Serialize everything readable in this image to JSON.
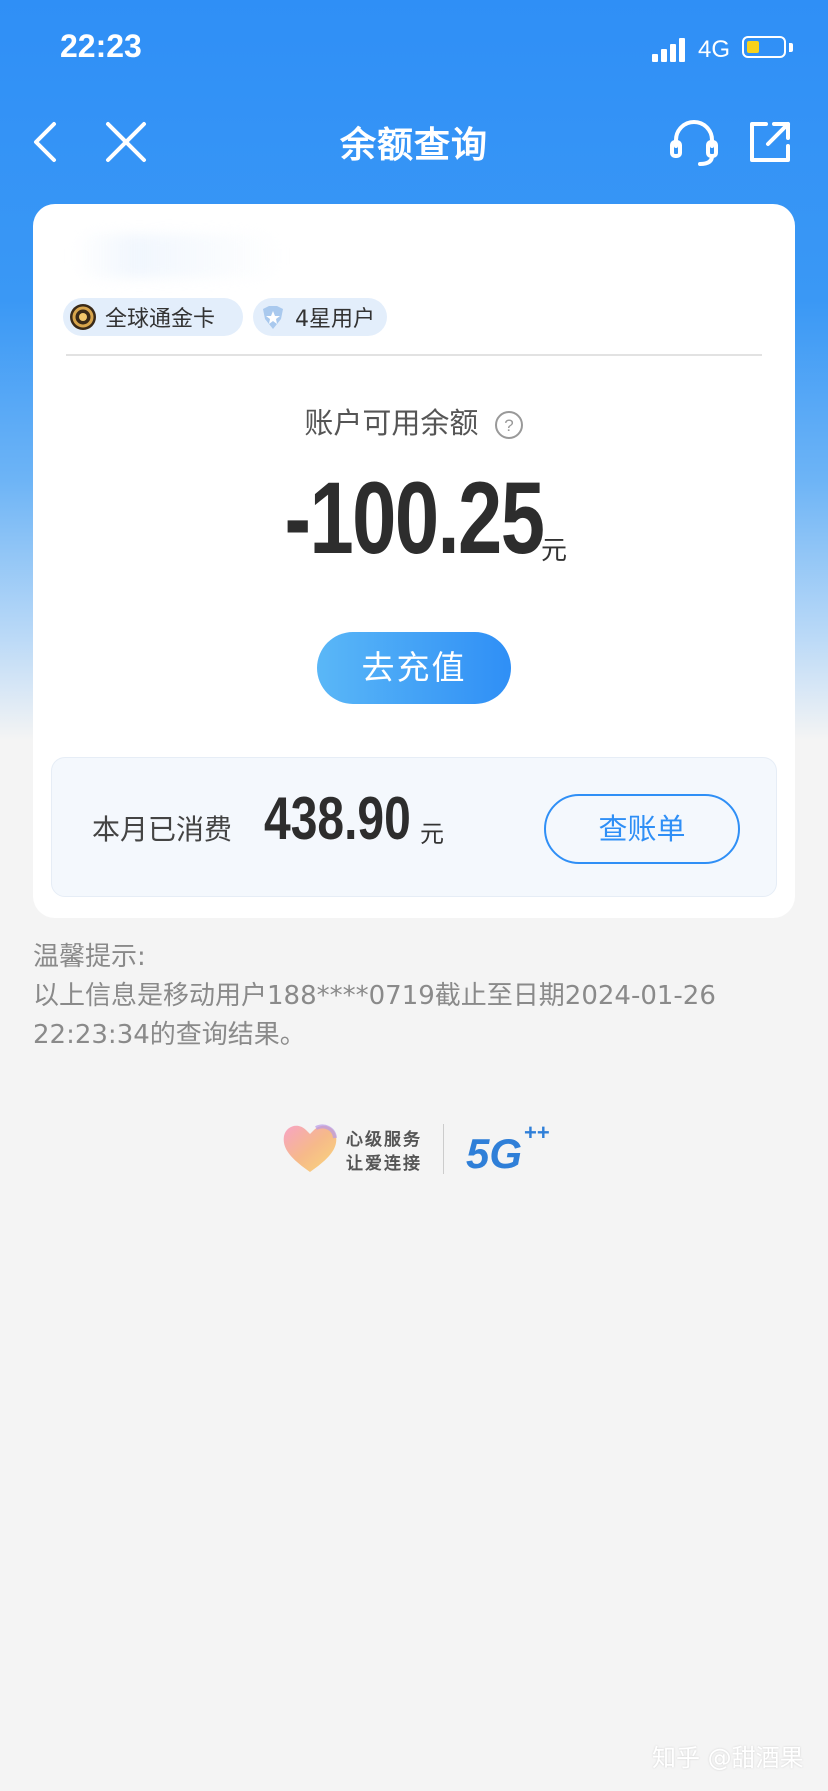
{
  "status_bar": {
    "time": "22:23",
    "network": "4G",
    "battery_level": 0.35,
    "signal_bars": 4
  },
  "nav": {
    "title": "余额查询",
    "icons": [
      "back-icon",
      "close-icon",
      "customer-service-icon",
      "share-icon"
    ]
  },
  "card": {
    "tags": [
      {
        "label": "全球通金卡",
        "icon": "gold-card-icon"
      },
      {
        "label": "4星用户",
        "icon": "star-badge-icon"
      }
    ],
    "balance_label": "账户可用余额",
    "balance_amount": "-100.25",
    "balance_unit": "元",
    "recharge_label": "去充值",
    "consume": {
      "label": "本月已消费",
      "amount": "438.90",
      "unit": "元",
      "bill_button": "查账单"
    }
  },
  "tips": {
    "title": "温馨提示:",
    "line1": "以上信息是移动用户188****0719截止至日期2024-01-26",
    "line2": "22:23:34的查询结果。"
  },
  "brand": {
    "slogan_line1": "心级服务",
    "slogan_line2": "让爱连接"
  },
  "watermark": "知乎 @甜酒果",
  "colors": {
    "primary": "#2f8ff6",
    "battery": "#f7d21b",
    "background": "#f4f4f4"
  }
}
